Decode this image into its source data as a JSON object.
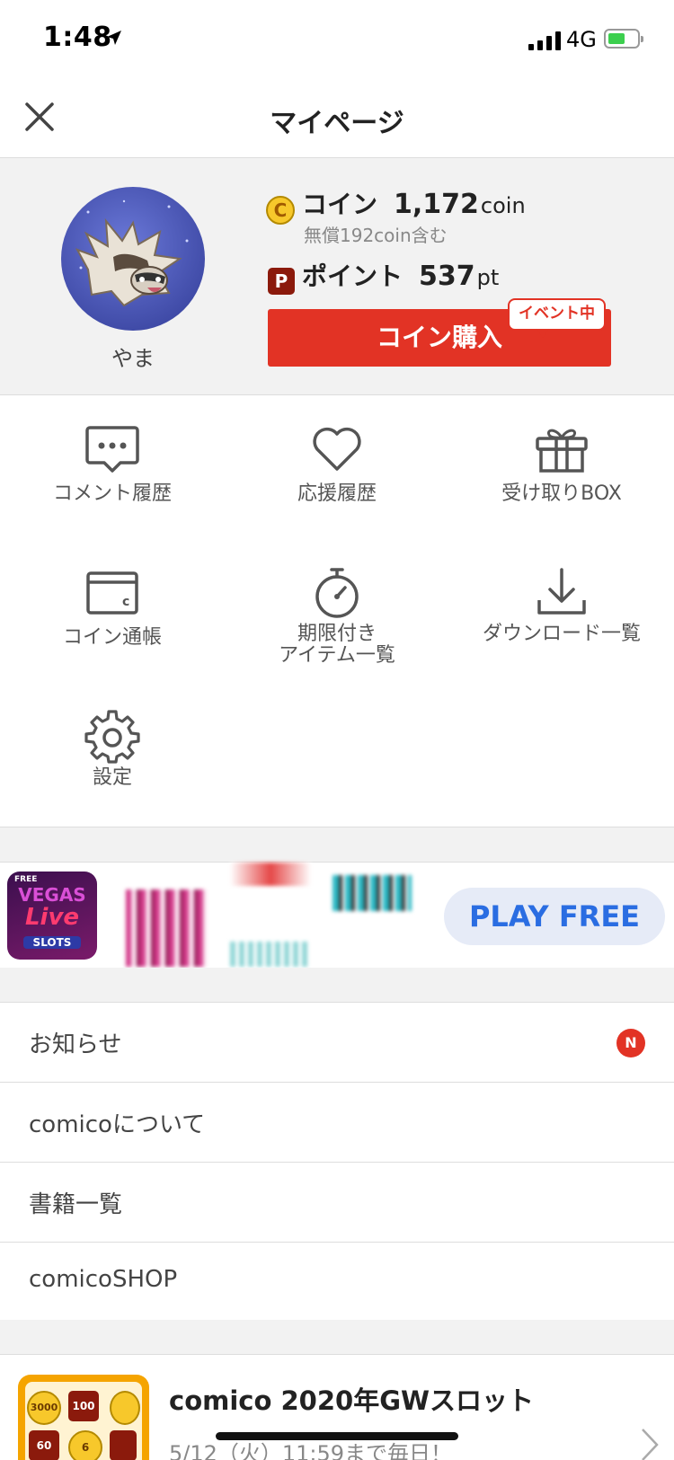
{
  "status_bar": {
    "time": "1:48",
    "network": "4G"
  },
  "header": {
    "title": "マイページ"
  },
  "profile": {
    "username": "やま",
    "coin_label": "コイン",
    "coin_value": "1,172",
    "coin_unit": "coin",
    "coin_badge": "C",
    "free_note": "無償192coin含む",
    "point_label": "ポイント",
    "point_value": "537",
    "point_unit": "pt",
    "point_badge": "P",
    "buy_button": "コイン購入",
    "event_tag": "イベント中"
  },
  "menu": {
    "comment_history": "コメント履歴",
    "support_history": "応援履歴",
    "gift_box": "受け取りBOX",
    "coin_ledger": "コイン通帳",
    "limited_items_line1": "期限付き",
    "limited_items_line2": "アイテム一覧",
    "download_list": "ダウンロード一覧",
    "settings": "設定"
  },
  "ad": {
    "icon_top": "FREE",
    "icon_line1": "VEGAS",
    "icon_line2": "Live",
    "icon_line3": "SLOTS",
    "button": "PLAY FREE"
  },
  "list": {
    "items": [
      {
        "label": "お知らせ",
        "badge": "N"
      },
      {
        "label": "comicoについて"
      },
      {
        "label": "書籍一覧"
      },
      {
        "label": "comicoSHOP"
      }
    ]
  },
  "promo": {
    "title": "comico 2020年GWスロット",
    "subtitle": "5/12（火）11:59まで毎日！",
    "thumb_values": [
      "3000",
      "100",
      "60",
      "6"
    ]
  },
  "colors": {
    "accent_red": "#e23325",
    "point_brown": "#8b1a0c",
    "coin_gold": "#f7c82b",
    "ad_blue": "#2a6de2"
  }
}
